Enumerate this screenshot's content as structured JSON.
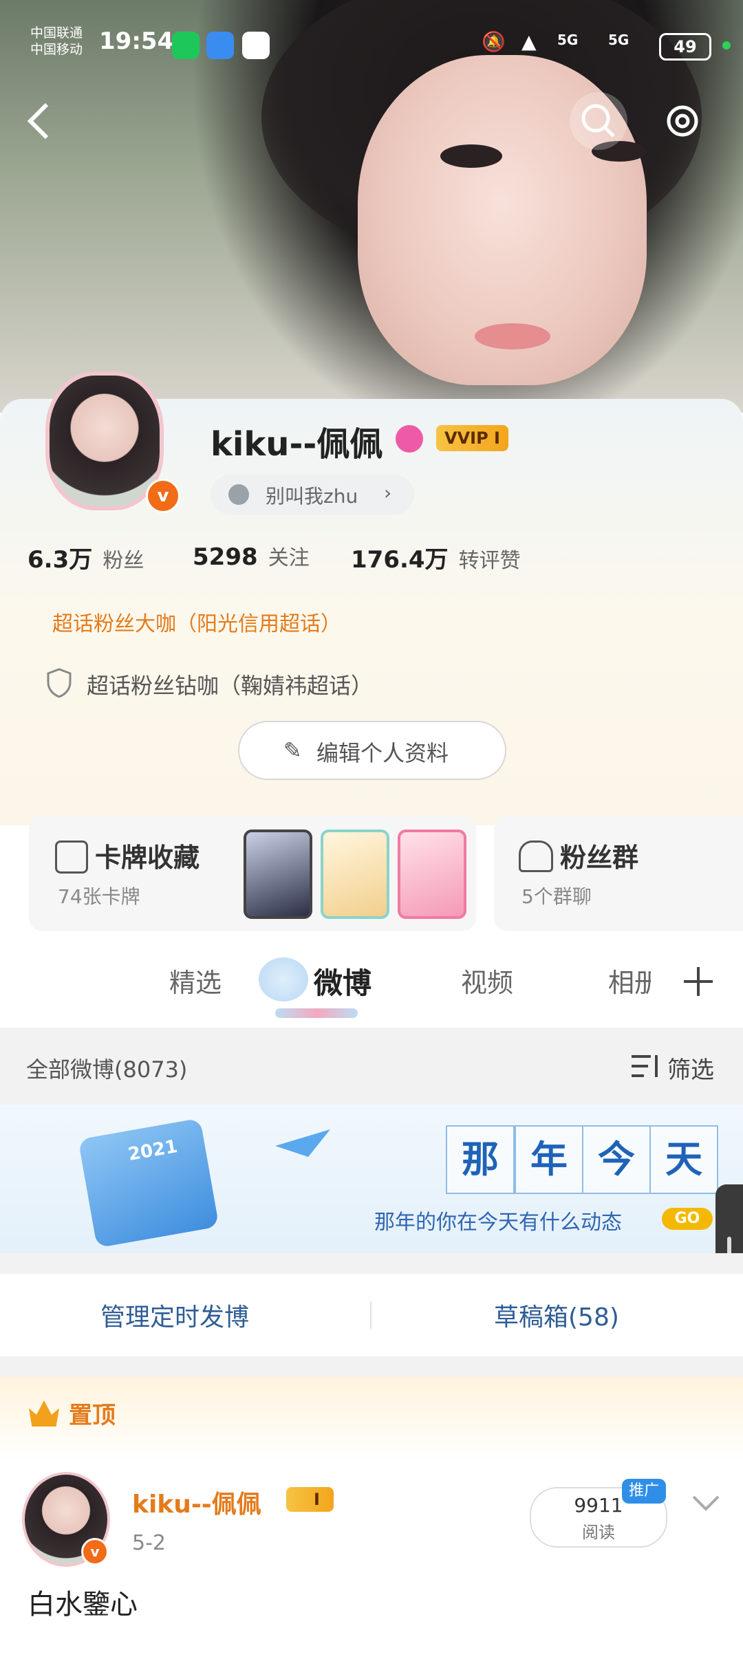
{
  "status_bar": {
    "carrier_1": "中国联通",
    "carrier_2": "中国移动",
    "time": "19:54",
    "signal_1": "5G",
    "signal_2": "5G",
    "battery": "49"
  },
  "profile": {
    "name": "kiku--佩佩",
    "vip_label": "VVIP I",
    "subtitle": "别叫我zhu",
    "counts": [
      {
        "value": "6.3万",
        "label": "粉丝"
      },
      {
        "value": "5298",
        "label": "关注"
      },
      {
        "value": "176.4万",
        "label": "转评赞"
      }
    ],
    "super_fan": "超话粉丝大咖（阳光信用超话）",
    "diamond_fan": "超话粉丝钻咖（鞠婧祎超话）",
    "edit_button": "编辑个人资料"
  },
  "cards": {
    "collection_title": "卡牌收藏",
    "collection_sub": "74张卡牌",
    "fan_group_title": "粉丝群",
    "fan_group_sub": "5个群聊"
  },
  "tabs": [
    "精选",
    "微博",
    "视频",
    "相册"
  ],
  "weibo_section": {
    "all_label": "全部微博(8073)",
    "filter_label": "筛选"
  },
  "banner": {
    "title_chars": [
      "那",
      "年",
      "今",
      "天"
    ],
    "subtitle": "那年的你在今天有什么动态",
    "go": "GO",
    "year": "2021"
  },
  "actions": {
    "scheduled": "管理定时发博",
    "drafts": "草稿箱(58)"
  },
  "pinned": {
    "label": "置顶",
    "author": "kiku--佩佩",
    "vip_small": "I",
    "date": "5-2",
    "reads_value": "9911",
    "reads_label": "阅读",
    "promo": "推广",
    "text": "白水鑒心"
  }
}
